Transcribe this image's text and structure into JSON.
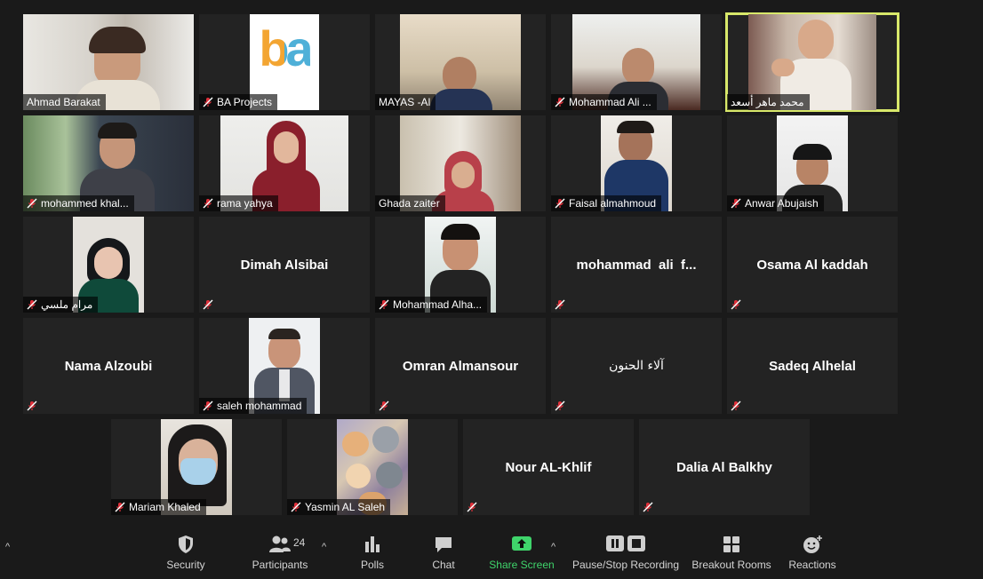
{
  "participants": [
    {
      "name": "Ahmad Barakat",
      "video": true,
      "muted": false
    },
    {
      "name": "BA Projects",
      "video": true,
      "muted": true,
      "logo_text": "ba"
    },
    {
      "name": "MAYAS -Al",
      "video": true,
      "muted": false
    },
    {
      "name": "Mohammad Ali ...",
      "video": true,
      "muted": true
    },
    {
      "name": "محمد ماهر أسعد",
      "video": true,
      "muted": false,
      "speaking": true
    },
    {
      "name": "mohammed khal...",
      "video": true,
      "muted": true
    },
    {
      "name": "rama yahya",
      "video": true,
      "muted": true
    },
    {
      "name": "Ghada zaiter",
      "video": true,
      "muted": false
    },
    {
      "name": "Faisal almahmoud",
      "video": true,
      "muted": true
    },
    {
      "name": "Anwar Abujaish",
      "video": true,
      "muted": true
    },
    {
      "name": "مرام ملسي",
      "video": true,
      "muted": true
    },
    {
      "name": "Dimah Alsibai",
      "video": false,
      "muted": true
    },
    {
      "name": "Mohammad Alha...",
      "video": true,
      "muted": true
    },
    {
      "name": "mohammad  ali  f...",
      "video": false,
      "muted": true
    },
    {
      "name": "Osama Al kaddah",
      "video": false,
      "muted": true
    },
    {
      "name": "Nama Alzoubi",
      "video": false,
      "muted": true
    },
    {
      "name": "saleh mohammad",
      "video": true,
      "muted": true
    },
    {
      "name": "Omran Almansour",
      "video": false,
      "muted": true
    },
    {
      "name": "آلاء الحنون",
      "video": false,
      "muted": true
    },
    {
      "name": "Sadeq Alhelal",
      "video": false,
      "muted": true
    },
    {
      "name": "Mariam Khaled",
      "video": true,
      "muted": true
    },
    {
      "name": "Yasmin AL Saleh",
      "video": true,
      "muted": true
    },
    {
      "name": "Nour AL-Khlif",
      "video": false,
      "muted": true
    },
    {
      "name": "Dalia Al Balkhy",
      "video": false,
      "muted": true
    }
  ],
  "toolbar": {
    "security": "Security",
    "participants": "Participants",
    "participants_count": "24",
    "polls": "Polls",
    "chat": "Chat",
    "share_screen": "Share Screen",
    "recording": "Pause/Stop Recording",
    "breakout": "Breakout Rooms",
    "reactions": "Reactions"
  },
  "colors": {
    "speaker_outline": "#d8e86a",
    "share_green": "#3fd46b",
    "mute_red": "#e0303a",
    "tile_bg": "#232323"
  }
}
